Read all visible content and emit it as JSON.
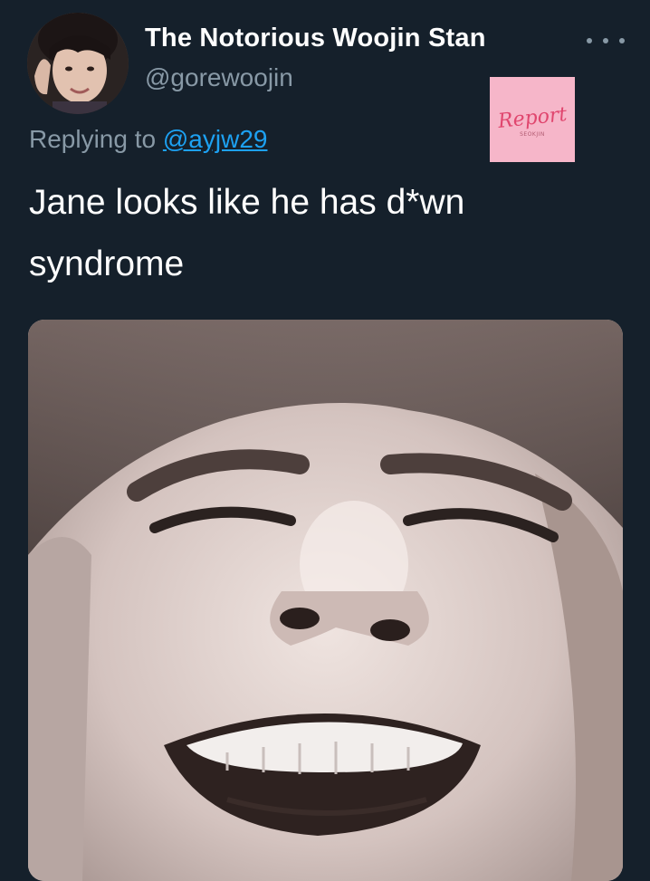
{
  "tweet": {
    "display_name": "The Notorious Woojin Stan",
    "handle": "@gorewoojin",
    "more_icon": "more-horizontal-icon",
    "reply_prefix": "Replying to",
    "reply_mention": "@ayjw29",
    "text": "Jane looks like he has d*wn syndrome",
    "sticker": {
      "label": "Report",
      "sub_label": "SEOKJIN"
    },
    "media_alt": "close-up photo of a smiling face"
  },
  "colors": {
    "background": "#15202b",
    "primary_text": "#ffffff",
    "secondary_text": "#8899a6",
    "link": "#1da1f2",
    "sticker_bg": "#f6b6c9"
  }
}
